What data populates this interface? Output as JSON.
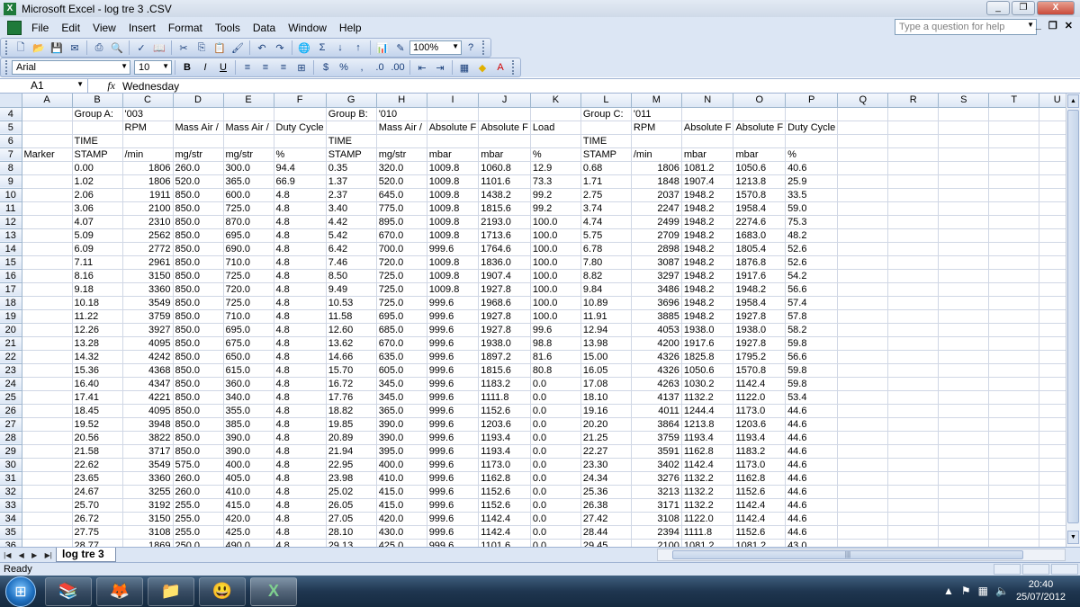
{
  "window": {
    "title": "Microsoft Excel - log tre 3 .CSV",
    "app_icon": "X"
  },
  "window_buttons": [
    "_",
    "❐",
    "X"
  ],
  "menu": [
    "File",
    "Edit",
    "View",
    "Insert",
    "Format",
    "Tools",
    "Data",
    "Window",
    "Help"
  ],
  "ask_box": {
    "placeholder": "Type a question for help"
  },
  "toolbar": {
    "zoom": "100%",
    "font_name": "Arial",
    "font_size": "10",
    "bold": "B",
    "italic": "I",
    "underline": "U",
    "sigma": "Σ",
    "percent": "%"
  },
  "formula_bar": {
    "cell": "A1",
    "fx": "fx",
    "value": "Wednesday"
  },
  "grid": {
    "col_headers": [
      "A",
      "B",
      "C",
      "D",
      "E",
      "F",
      "G",
      "H",
      "I",
      "J",
      "K",
      "L",
      "M",
      "N",
      "O",
      "P",
      "Q",
      "R",
      "S",
      "T",
      "U"
    ],
    "rows": [
      {
        "n": "4",
        "cells": [
          "",
          "Group A:",
          "'003",
          "",
          "",
          "",
          "Group B:",
          "'010",
          "",
          "",
          "",
          "Group C:",
          "'011",
          "",
          "",
          "",
          "",
          "",
          "",
          "",
          ""
        ]
      },
      {
        "n": "5",
        "cells": [
          "",
          "",
          "RPM",
          "Mass Air /",
          "Mass Air /",
          "Duty Cycle",
          "",
          "Mass Air /",
          "Absolute F",
          "Absolute F",
          "Load",
          "",
          "RPM",
          "Absolute F",
          "Absolute F",
          "Duty Cycle",
          "",
          "",
          "",
          "",
          ""
        ]
      },
      {
        "n": "6",
        "cells": [
          "",
          "TIME",
          "",
          "",
          "",
          "",
          "TIME",
          "",
          "",
          "",
          "",
          "TIME",
          "",
          "",
          "",
          "",
          "",
          "",
          "",
          "",
          ""
        ]
      },
      {
        "n": "7",
        "cells": [
          "Marker",
          "STAMP",
          "/min",
          "mg/str",
          "mg/str",
          "%",
          "STAMP",
          "mg/str",
          "mbar",
          "mbar",
          "%",
          "STAMP",
          "/min",
          "mbar",
          "mbar",
          "%",
          "",
          "",
          "",
          "",
          ""
        ]
      },
      {
        "n": "8",
        "cells": [
          "",
          "0.00",
          "1806",
          "260.0",
          "300.0",
          "94.4",
          "0.35",
          "320.0",
          "1009.8",
          "1060.8",
          "12.9",
          "0.68",
          "1806",
          "1081.2",
          "1050.6",
          "40.6",
          "",
          "",
          "",
          "",
          ""
        ]
      },
      {
        "n": "9",
        "cells": [
          "",
          "1.02",
          "1806",
          "520.0",
          "365.0",
          "66.9",
          "1.37",
          "520.0",
          "1009.8",
          "1101.6",
          "73.3",
          "1.71",
          "1848",
          "1907.4",
          "1213.8",
          "25.9",
          "",
          "",
          "",
          "",
          ""
        ]
      },
      {
        "n": "10",
        "cells": [
          "",
          "2.06",
          "1911",
          "850.0",
          "600.0",
          "4.8",
          "2.37",
          "645.0",
          "1009.8",
          "1438.2",
          "99.2",
          "2.75",
          "2037",
          "1948.2",
          "1570.8",
          "33.5",
          "",
          "",
          "",
          "",
          ""
        ]
      },
      {
        "n": "11",
        "cells": [
          "",
          "3.06",
          "2100",
          "850.0",
          "725.0",
          "4.8",
          "3.40",
          "775.0",
          "1009.8",
          "1815.6",
          "99.2",
          "3.74",
          "2247",
          "1948.2",
          "1958.4",
          "59.0",
          "",
          "",
          "",
          "",
          ""
        ]
      },
      {
        "n": "12",
        "cells": [
          "",
          "4.07",
          "2310",
          "850.0",
          "870.0",
          "4.8",
          "4.42",
          "895.0",
          "1009.8",
          "2193.0",
          "100.0",
          "4.74",
          "2499",
          "1948.2",
          "2274.6",
          "75.3",
          "",
          "",
          "",
          "",
          ""
        ]
      },
      {
        "n": "13",
        "cells": [
          "",
          "5.09",
          "2562",
          "850.0",
          "695.0",
          "4.8",
          "5.42",
          "670.0",
          "1009.8",
          "1713.6",
          "100.0",
          "5.75",
          "2709",
          "1948.2",
          "1683.0",
          "48.2",
          "",
          "",
          "",
          "",
          ""
        ]
      },
      {
        "n": "14",
        "cells": [
          "",
          "6.09",
          "2772",
          "850.0",
          "690.0",
          "4.8",
          "6.42",
          "700.0",
          "999.6",
          "1764.6",
          "100.0",
          "6.78",
          "2898",
          "1948.2",
          "1805.4",
          "52.6",
          "",
          "",
          "",
          "",
          ""
        ]
      },
      {
        "n": "15",
        "cells": [
          "",
          "7.11",
          "2961",
          "850.0",
          "710.0",
          "4.8",
          "7.46",
          "720.0",
          "1009.8",
          "1836.0",
          "100.0",
          "7.80",
          "3087",
          "1948.2",
          "1876.8",
          "52.6",
          "",
          "",
          "",
          "",
          ""
        ]
      },
      {
        "n": "16",
        "cells": [
          "",
          "8.16",
          "3150",
          "850.0",
          "725.0",
          "4.8",
          "8.50",
          "725.0",
          "1009.8",
          "1907.4",
          "100.0",
          "8.82",
          "3297",
          "1948.2",
          "1917.6",
          "54.2",
          "",
          "",
          "",
          "",
          ""
        ]
      },
      {
        "n": "17",
        "cells": [
          "",
          "9.18",
          "3360",
          "850.0",
          "720.0",
          "4.8",
          "9.49",
          "725.0",
          "1009.8",
          "1927.8",
          "100.0",
          "9.84",
          "3486",
          "1948.2",
          "1948.2",
          "56.6",
          "",
          "",
          "",
          "",
          ""
        ]
      },
      {
        "n": "18",
        "cells": [
          "",
          "10.18",
          "3549",
          "850.0",
          "725.0",
          "4.8",
          "10.53",
          "725.0",
          "999.6",
          "1968.6",
          "100.0",
          "10.89",
          "3696",
          "1948.2",
          "1958.4",
          "57.4",
          "",
          "",
          "",
          "",
          ""
        ]
      },
      {
        "n": "19",
        "cells": [
          "",
          "11.22",
          "3759",
          "850.0",
          "710.0",
          "4.8",
          "11.58",
          "695.0",
          "999.6",
          "1927.8",
          "100.0",
          "11.91",
          "3885",
          "1948.2",
          "1927.8",
          "57.8",
          "",
          "",
          "",
          "",
          ""
        ]
      },
      {
        "n": "20",
        "cells": [
          "",
          "12.26",
          "3927",
          "850.0",
          "695.0",
          "4.8",
          "12.60",
          "685.0",
          "999.6",
          "1927.8",
          "99.6",
          "12.94",
          "4053",
          "1938.0",
          "1938.0",
          "58.2",
          "",
          "",
          "",
          "",
          ""
        ]
      },
      {
        "n": "21",
        "cells": [
          "",
          "13.28",
          "4095",
          "850.0",
          "675.0",
          "4.8",
          "13.62",
          "670.0",
          "999.6",
          "1938.0",
          "98.8",
          "13.98",
          "4200",
          "1917.6",
          "1927.8",
          "59.8",
          "",
          "",
          "",
          "",
          ""
        ]
      },
      {
        "n": "22",
        "cells": [
          "",
          "14.32",
          "4242",
          "850.0",
          "650.0",
          "4.8",
          "14.66",
          "635.0",
          "999.6",
          "1897.2",
          "81.6",
          "15.00",
          "4326",
          "1825.8",
          "1795.2",
          "56.6",
          "",
          "",
          "",
          "",
          ""
        ]
      },
      {
        "n": "23",
        "cells": [
          "",
          "15.36",
          "4368",
          "850.0",
          "615.0",
          "4.8",
          "15.70",
          "605.0",
          "999.6",
          "1815.6",
          "80.8",
          "16.05",
          "4326",
          "1050.6",
          "1570.8",
          "59.8",
          "",
          "",
          "",
          "",
          ""
        ]
      },
      {
        "n": "24",
        "cells": [
          "",
          "16.40",
          "4347",
          "850.0",
          "360.0",
          "4.8",
          "16.72",
          "345.0",
          "999.6",
          "1183.2",
          "0.0",
          "17.08",
          "4263",
          "1030.2",
          "1142.4",
          "59.8",
          "",
          "",
          "",
          "",
          ""
        ]
      },
      {
        "n": "25",
        "cells": [
          "",
          "17.41",
          "4221",
          "850.0",
          "340.0",
          "4.8",
          "17.76",
          "345.0",
          "999.6",
          "1111.8",
          "0.0",
          "18.10",
          "4137",
          "1132.2",
          "1122.0",
          "53.4",
          "",
          "",
          "",
          "",
          ""
        ]
      },
      {
        "n": "26",
        "cells": [
          "",
          "18.45",
          "4095",
          "850.0",
          "355.0",
          "4.8",
          "18.82",
          "365.0",
          "999.6",
          "1152.6",
          "0.0",
          "19.16",
          "4011",
          "1244.4",
          "1173.0",
          "44.6",
          "",
          "",
          "",
          "",
          ""
        ]
      },
      {
        "n": "27",
        "cells": [
          "",
          "19.52",
          "3948",
          "850.0",
          "385.0",
          "4.8",
          "19.85",
          "390.0",
          "999.6",
          "1203.6",
          "0.0",
          "20.20",
          "3864",
          "1213.8",
          "1203.6",
          "44.6",
          "",
          "",
          "",
          "",
          ""
        ]
      },
      {
        "n": "28",
        "cells": [
          "",
          "20.56",
          "3822",
          "850.0",
          "390.0",
          "4.8",
          "20.89",
          "390.0",
          "999.6",
          "1193.4",
          "0.0",
          "21.25",
          "3759",
          "1193.4",
          "1193.4",
          "44.6",
          "",
          "",
          "",
          "",
          ""
        ]
      },
      {
        "n": "29",
        "cells": [
          "",
          "21.58",
          "3717",
          "850.0",
          "390.0",
          "4.8",
          "21.94",
          "395.0",
          "999.6",
          "1193.4",
          "0.0",
          "22.27",
          "3591",
          "1162.8",
          "1183.2",
          "44.6",
          "",
          "",
          "",
          "",
          ""
        ]
      },
      {
        "n": "30",
        "cells": [
          "",
          "22.62",
          "3549",
          "575.0",
          "400.0",
          "4.8",
          "22.95",
          "400.0",
          "999.6",
          "1173.0",
          "0.0",
          "23.30",
          "3402",
          "1142.4",
          "1173.0",
          "44.6",
          "",
          "",
          "",
          "",
          ""
        ]
      },
      {
        "n": "31",
        "cells": [
          "",
          "23.65",
          "3360",
          "260.0",
          "405.0",
          "4.8",
          "23.98",
          "410.0",
          "999.6",
          "1162.8",
          "0.0",
          "24.34",
          "3276",
          "1132.2",
          "1162.8",
          "44.6",
          "",
          "",
          "",
          "",
          ""
        ]
      },
      {
        "n": "32",
        "cells": [
          "",
          "24.67",
          "3255",
          "260.0",
          "410.0",
          "4.8",
          "25.02",
          "415.0",
          "999.6",
          "1152.6",
          "0.0",
          "25.36",
          "3213",
          "1132.2",
          "1152.6",
          "44.6",
          "",
          "",
          "",
          "",
          ""
        ]
      },
      {
        "n": "33",
        "cells": [
          "",
          "25.70",
          "3192",
          "255.0",
          "415.0",
          "4.8",
          "26.05",
          "415.0",
          "999.6",
          "1152.6",
          "0.0",
          "26.38",
          "3171",
          "1132.2",
          "1142.4",
          "44.6",
          "",
          "",
          "",
          "",
          ""
        ]
      },
      {
        "n": "34",
        "cells": [
          "",
          "26.72",
          "3150",
          "255.0",
          "420.0",
          "4.8",
          "27.05",
          "420.0",
          "999.6",
          "1142.4",
          "0.0",
          "27.42",
          "3108",
          "1122.0",
          "1142.4",
          "44.6",
          "",
          "",
          "",
          "",
          ""
        ]
      },
      {
        "n": "35",
        "cells": [
          "",
          "27.75",
          "3108",
          "255.0",
          "425.0",
          "4.8",
          "28.10",
          "430.0",
          "999.6",
          "1142.4",
          "0.0",
          "28.44",
          "2394",
          "1111.8",
          "1152.6",
          "44.6",
          "",
          "",
          "",
          "",
          ""
        ]
      },
      {
        "n": "36",
        "cells": [
          "",
          "28.77",
          "1869",
          "250.0",
          "490.0",
          "4.8",
          "29.13",
          "425.0",
          "999.6",
          "1101.6",
          "0.0",
          "29.45",
          "2100",
          "1081.2",
          "1081.2",
          "43.0",
          "",
          "",
          "",
          "",
          ""
        ]
      }
    ]
  },
  "sheet_tabs": [
    "log tre 3"
  ],
  "status": {
    "text": "Ready"
  },
  "taskbar": {
    "apps": [
      "start-orb",
      "winrar-icon",
      "firefox-icon",
      "explorer-icon",
      "yahoo-messenger-icon",
      "excel-icon"
    ],
    "clock_time": "20:40",
    "clock_date": "25/07/2012"
  }
}
